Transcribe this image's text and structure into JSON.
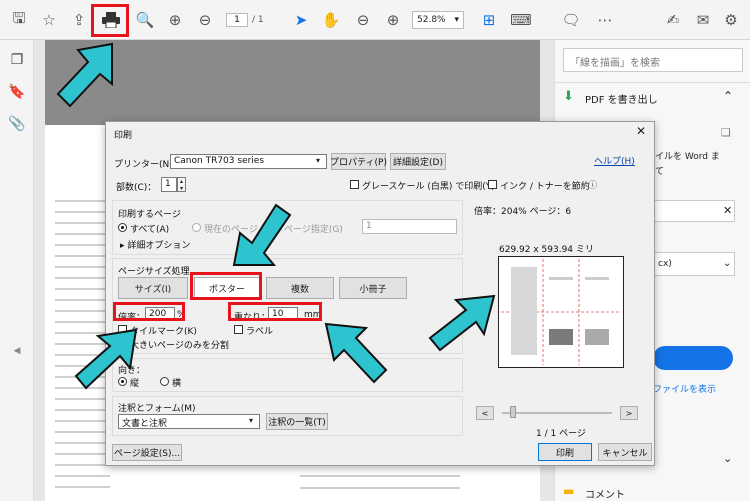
{
  "toolbar": {
    "page_current": "1",
    "page_total": "/ 1",
    "zoom": "52.8%",
    "accent": "#1473e6"
  },
  "right_panel": {
    "search_placeholder": "「線を描画」を検索",
    "export_title": "PDF を書き出し",
    "partial_text_1": "イルを Word ま",
    "partial_text_2": "て",
    "partial_dropdown": "cx)",
    "show_file_link": "ファイルを表示",
    "comment_label": "コメント"
  },
  "dialog": {
    "title": "印刷",
    "help_link": "ヘルプ(H)",
    "printer_label": "プリンター(N)：",
    "printer_name": "Canon TR703 series",
    "properties_button": "プロパティ(P)",
    "advanced_button": "詳細設定(D)",
    "copies_label": "部数(C)：",
    "copies_value": "1",
    "grayscale_label": "グレースケール (白黒) で印刷(Y)",
    "save_ink_label": "インク / トナーを節約",
    "pages_heading": "印刷するページ",
    "all_label": "すべて(A)",
    "current_page_label": "現在のページ",
    "page_specify_label": "ページ指定(G)",
    "page_specify_value": "1",
    "more_options_label": "▸ 詳細オプション",
    "sizing_heading": "ページサイズ処理",
    "tab_size": "サイズ(I)",
    "tab_poster": "ポスター",
    "tab_multiple": "複数",
    "tab_booklet": "小冊子",
    "scale_label": "倍率：",
    "scale_value": "200",
    "scale_unit": "%",
    "overlap_label": "重なり：",
    "overlap_value": "10",
    "overlap_unit": "mm",
    "tile_marks_label": "タイルマーク(K)",
    "labels_label": "ラベル",
    "large_pages_only_label": "大きいページのみを分割",
    "orientation_heading": "向き：",
    "portrait_label": "縦",
    "landscape_label": "横",
    "comments_heading": "注釈とフォーム(M)",
    "comments_value": "文書と注釈",
    "comments_summary_button": "注釈の一覧(T)",
    "page_setup_button": "ページ設定(S)...",
    "preview_scale": "倍率：204% ページ：6",
    "preview_size": "629.92 x 593.94 ミリ",
    "page_indicator": "1 / 1 ページ",
    "print_button": "印刷",
    "cancel_button": "キャンセル"
  }
}
